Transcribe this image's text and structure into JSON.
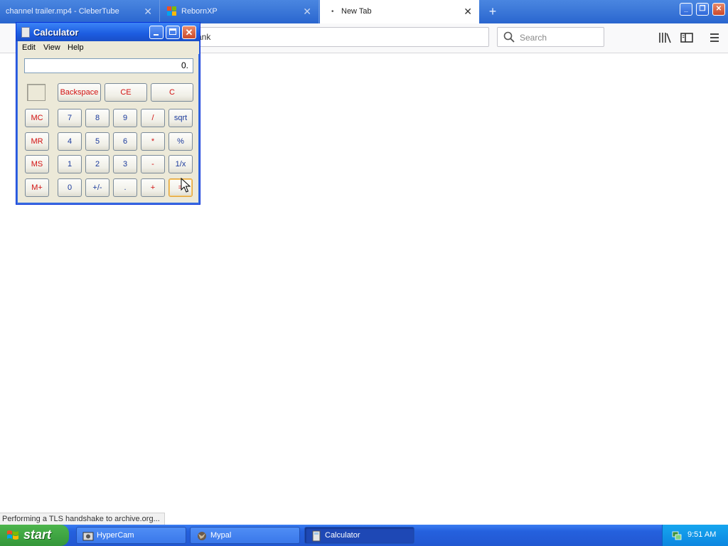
{
  "browser": {
    "tabs": [
      {
        "label": "channel trailer.mp4 - CleberTube",
        "active": false
      },
      {
        "label": "RebornXP",
        "active": false
      },
      {
        "label": "New Tab",
        "active": true
      }
    ],
    "address_fragment": "ank",
    "search_placeholder": "Search"
  },
  "calculator": {
    "title": "Calculator",
    "menu": [
      "Edit",
      "View",
      "Help"
    ],
    "display": "0.",
    "buttons": {
      "backspace": "Backspace",
      "ce": "CE",
      "c": "C",
      "mc": "MC",
      "mr": "MR",
      "ms": "MS",
      "mplus": "M+",
      "n7": "7",
      "n8": "8",
      "n9": "9",
      "div": "/",
      "sqrt": "sqrt",
      "n4": "4",
      "n5": "5",
      "n6": "6",
      "mul": "*",
      "pct": "%",
      "n1": "1",
      "n2": "2",
      "n3": "3",
      "sub": "-",
      "inv": "1/x",
      "n0": "0",
      "sign": "+/-",
      "dot": ".",
      "add": "+",
      "eq": "="
    }
  },
  "status_text": "Performing a TLS handshake to archive.org...",
  "taskbar": {
    "start_label": "start",
    "items": [
      {
        "label": "HyperCam",
        "active": false
      },
      {
        "label": "Mypal",
        "active": false
      },
      {
        "label": "Calculator",
        "active": true
      }
    ],
    "clock": "9:51 AM"
  },
  "colors": {
    "taskbar_blue": "#2561de",
    "start_green": "#3ea83f",
    "calc_blue_digits": "#1a3a9c",
    "calc_red_ops": "#d21010"
  }
}
